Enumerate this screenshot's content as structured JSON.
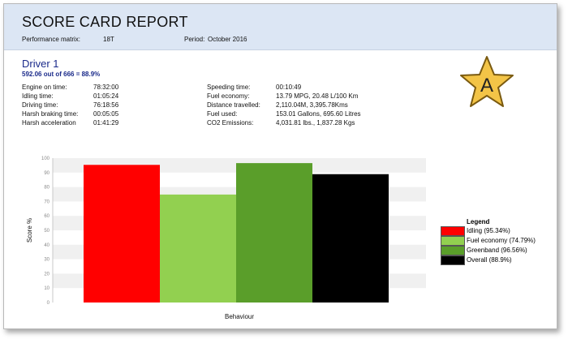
{
  "header": {
    "title": "SCORE CARD REPORT",
    "matrix_label": "Performance matrix:",
    "matrix_value": "18T",
    "period_label": "Period:",
    "period_value": "October 2016"
  },
  "driver": {
    "name": "Driver 1",
    "score_text": "592.06 out of 666 = 88.9%"
  },
  "stats_left": [
    {
      "label": "Engine on time:",
      "value": "78:32:00"
    },
    {
      "label": "Idling time:",
      "value": "01:05:24"
    },
    {
      "label": "Driving time:",
      "value": "76:18:56"
    },
    {
      "label": "Harsh braking time:",
      "value": "00:05:05"
    },
    {
      "label": "Harsh acceleration",
      "value": "01:41:29"
    }
  ],
  "stats_right": [
    {
      "label": "Speeding time:",
      "value": "00:10:49"
    },
    {
      "label": "Fuel economy:",
      "value": "13.79 MPG, 20.48 L/100 Km"
    },
    {
      "label": "Distance travelled:",
      "value": "2,110.04M, 3,395.78Kms"
    },
    {
      "label": "Fuel used:",
      "value": "153.01 Gallons, 695.60 Litres"
    },
    {
      "label": "CO2 Emissions:",
      "value": "4,031.81 lbs., 1,837.28 Kgs"
    }
  ],
  "badge": {
    "grade": "A",
    "icon": "star-icon",
    "fill": "#f3c447",
    "stroke": "#7a5a10"
  },
  "legend": {
    "title": "Legend",
    "items": [
      {
        "label": "Idling  (95.34%)",
        "color": "#ff0000"
      },
      {
        "label": "Fuel economy (74.79%)",
        "color": "#92d050"
      },
      {
        "label": "Greenband (96.56%)",
        "color": "#5a9e2a"
      },
      {
        "label": "Overall (88.9%)",
        "color": "#000000"
      }
    ]
  },
  "chart_data": {
    "type": "bar",
    "categories": [
      "Idling",
      "Fuel economy",
      "Greenband",
      "Overall"
    ],
    "values": [
      95.34,
      74.79,
      96.56,
      88.9
    ],
    "colors": [
      "#ff0000",
      "#92d050",
      "#5a9e2a",
      "#000000"
    ],
    "xlabel": "Behaviour",
    "ylabel": "Score %",
    "ylim": [
      0,
      100
    ],
    "yticks": [
      0,
      10,
      20,
      30,
      40,
      50,
      60,
      70,
      80,
      90,
      100
    ],
    "grid": "horizontal bands"
  }
}
